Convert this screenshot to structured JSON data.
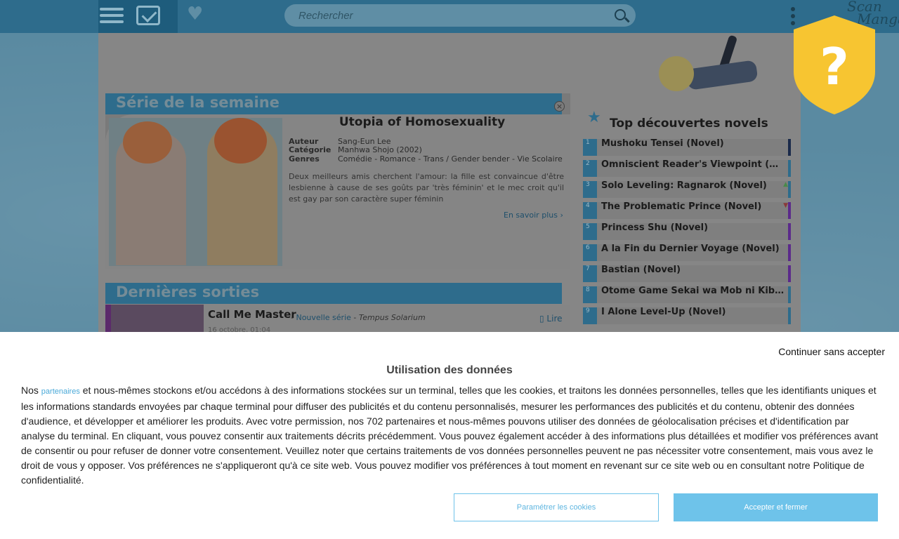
{
  "header": {
    "search_placeholder": "Rechercher",
    "logo_line1": "Scan",
    "logo_line2": "Manga"
  },
  "series_of_week": {
    "section_title": "Série de la semaine",
    "title": "Utopia of Homosexuality",
    "meta": [
      {
        "key": "Auteur",
        "value": "Sang-Eun Lee"
      },
      {
        "key": "Catégorie",
        "value": "Manhwa Shojo (2002)"
      },
      {
        "key": "Genres",
        "value": "Comédie - Romance - Trans / Gender bender - Vie Scolaire"
      }
    ],
    "synopsis": "Deux meilleurs amis cherchent l'amour: la fille est convaincue d'être lesbienne à cause de ses goûts par 'très féminin' et le mec croit qu'il est gay par son caractère super féminin",
    "more_link": "En savoir plus ›"
  },
  "latest": {
    "section_title": "Dernières sorties",
    "items": [
      {
        "title": "Call Me Master",
        "tag": "Nouvelle série",
        "team": "Tempus Solarium",
        "date": "16 octobre, 01:04",
        "read": "Lire"
      }
    ]
  },
  "top_novels": {
    "title": "Top découvertes novels",
    "items": [
      {
        "rank": "1",
        "title": "Mushoku Tensei (Novel)",
        "flag": "#1a2a4a",
        "trend": ""
      },
      {
        "rank": "2",
        "title": "Omniscient Reader's Viewpoint (Novel)",
        "flag": "#2e6c8c",
        "trend": ""
      },
      {
        "rank": "3",
        "title": "Solo Leveling: Ragnarok (Novel)",
        "flag": "#2e6c8c",
        "trend": "up"
      },
      {
        "rank": "4",
        "title": "The Problematic Prince (Novel)",
        "flag": "#5b2a8b",
        "trend": "down"
      },
      {
        "rank": "5",
        "title": "Princess Shu (Novel)",
        "flag": "#5b2a8b",
        "trend": ""
      },
      {
        "rank": "6",
        "title": "A la Fin du Dernier Voyage (Novel)",
        "flag": "#5b2a8b",
        "trend": ""
      },
      {
        "rank": "7",
        "title": "Bastian (Novel)",
        "flag": "#5b2a8b",
        "trend": ""
      },
      {
        "rank": "8",
        "title": "Otome Game Sekai wa Mob ni Kibishii Sekai desu (Novel)",
        "flag": "#2e6c8c",
        "trend": ""
      },
      {
        "rank": "9",
        "title": "I Alone Level-Up (Novel)",
        "flag": "#2e6c8c",
        "trend": ""
      }
    ]
  },
  "consent": {
    "continue_label": "Continuer sans accepter",
    "title": "Utilisation des données",
    "body_prefix": "Nos ",
    "partners_link": "partenaires",
    "body_rest": " et nous-mêmes stockons et/ou accédons à des informations stockées sur un terminal, telles que les cookies, et traitons les données personnelles, telles que les identifiants uniques et les informations standards envoyées par chaque terminal pour diffuser des publicités et du contenu personnalisés, mesurer les performances des publicités et du contenu, obtenir des données d'audience, et développer et améliorer les produits. Avec votre permission, nos 702 partenaires et nous-mêmes pouvons utiliser des données de géolocalisation précises et d'identification par analyse du terminal. En cliquant, vous pouvez consentir aux traitements décrits précédemment. Vous pouvez également accéder à des informations plus détaillées et modifier vos préférences avant de consentir ou pour refuser de donner votre consentement. Veuillez noter que certains traitements de vos données personnelles peuvent ne pas nécessiter votre consentement, mais vous avez le droit de vous y opposer. Vos préférences ne s'appliqueront qu'à ce site web. Vous pouvez modifier vos préférences à tout moment en revenant sur ce site web ou en consultant notre Politique de confidentialité.",
    "settings_button": "Paramétrer les cookies",
    "accept_button": "Accepter et fermer"
  },
  "colors": {
    "accent": "#2e6c8c",
    "consent_button": "#6ec3ea",
    "shield": "#f7c531"
  },
  "icons": [
    "menu-icon",
    "mail-icon",
    "heart-icon",
    "search-icon",
    "kebab-icon",
    "star-icon",
    "close-icon",
    "shield-question-icon"
  ]
}
